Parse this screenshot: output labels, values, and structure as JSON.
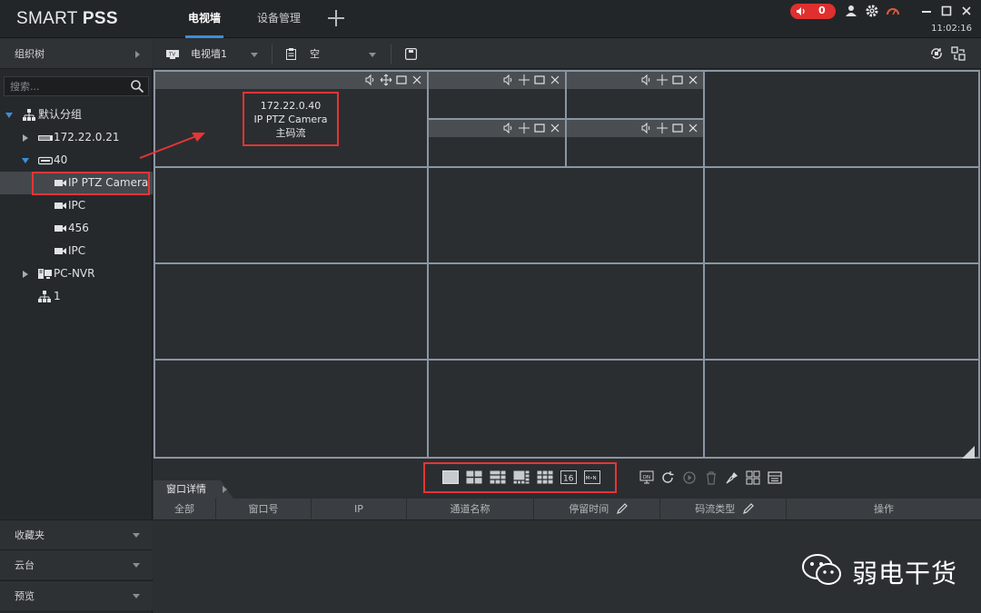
{
  "app": {
    "logo_normal": "SMART ",
    "logo_bold": "PSS",
    "time": "11:02:16",
    "alarm_count": "0"
  },
  "tabs": [
    {
      "label": "电视墙",
      "active": true
    },
    {
      "label": "设备管理",
      "active": false
    }
  ],
  "left": {
    "header": "组织树",
    "search_placeholder": "搜索...",
    "tree": [
      {
        "label": "默认分组",
        "icon": "org-icon",
        "expand": "down"
      },
      {
        "label": "172.22.0.21",
        "icon": "nvr-icon",
        "expand": "right"
      },
      {
        "label": "40",
        "icon": "dvr-icon",
        "expand": "down"
      },
      {
        "label": "IP PTZ Camera",
        "icon": "camera-icon",
        "selected": true
      },
      {
        "label": "IPC",
        "icon": "camera-icon"
      },
      {
        "label": "456",
        "icon": "camera-icon"
      },
      {
        "label": "IPC",
        "icon": "camera-icon"
      },
      {
        "label": "PC-NVR",
        "icon": "pc-nvr-icon",
        "expand": "right"
      },
      {
        "label": "1",
        "icon": "org-icon"
      }
    ],
    "footer": [
      "收藏夹",
      "云台",
      "预览"
    ]
  },
  "toolbar": {
    "wall_name": "电视墙1",
    "plan_name": "空"
  },
  "wall": {
    "info": {
      "ip": "172.22.0.40",
      "device": "IP PTZ Camera",
      "stream": "主码流"
    }
  },
  "details": {
    "tab": "窗口详情",
    "columns": [
      "全部",
      "窗口号",
      "IP",
      "通道名称",
      "停留时间",
      "码流类型",
      "操作"
    ]
  },
  "watermark": {
    "text": "弱电干货"
  },
  "colors": {
    "accent": "#3c8fd8",
    "highlight": "#e53535",
    "alarm": "#e02f2f"
  }
}
